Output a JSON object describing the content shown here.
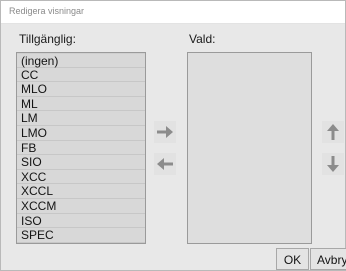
{
  "window": {
    "title": "Redigera visningar"
  },
  "available": {
    "label": "Tillgänglig:",
    "items": [
      "(ingen)",
      "CC",
      "MLO",
      "ML",
      "LM",
      "LMO",
      "FB",
      "SIO",
      "XCC",
      "XCCL",
      "XCCM",
      "ISO",
      "SPEC"
    ]
  },
  "selected": {
    "label": "Vald:",
    "items": []
  },
  "buttons": {
    "ok": "OK",
    "cancel": "Avbryt"
  },
  "icons": {
    "add": "arrow-right-icon",
    "remove": "arrow-left-icon",
    "move_up": "arrow-up-icon",
    "move_down": "arrow-down-icon"
  },
  "colors": {
    "icon": "#8c8c8c",
    "list_bg": "#dedede"
  }
}
